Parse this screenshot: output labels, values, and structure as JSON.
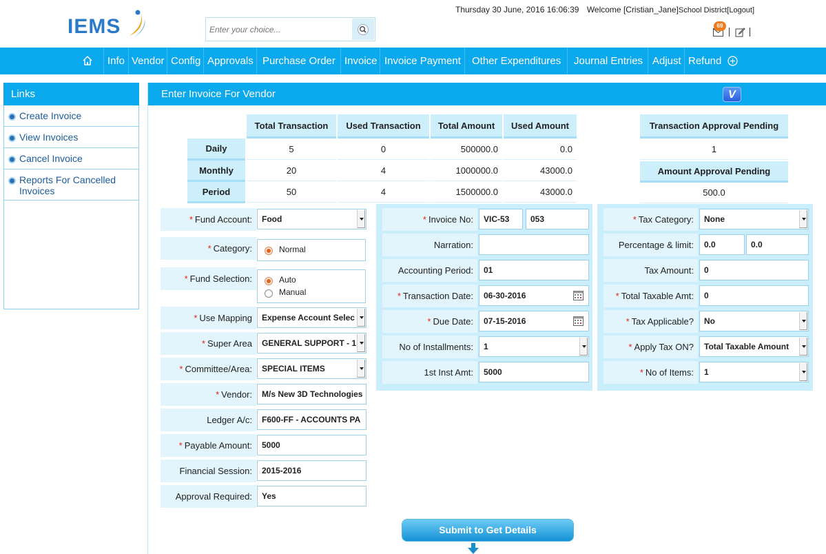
{
  "header": {
    "logo_text": "IEMS",
    "search_placeholder": "Enter your choice...",
    "datetime": "Thursday 30 June, 2016 16:06:39",
    "welcome": "Welcome [Cristian_Jane]",
    "district": "School District",
    "logout": "[Logout]",
    "mail_count": "69"
  },
  "nav": {
    "items": [
      "Info",
      "Vendor",
      "Config",
      "Approvals",
      "Purchase Order",
      "Invoice",
      "Invoice Payment",
      "Other Expenditures",
      "Journal Entries",
      "Adjust",
      "Refund"
    ]
  },
  "sidebar": {
    "title": "Links",
    "items": [
      "Create Invoice",
      "View Invoices",
      "Cancel Invoice",
      "Reports For Cancelled Invoices"
    ]
  },
  "main": {
    "title": "Enter Invoice For Vendor",
    "v_button": "V"
  },
  "stats": {
    "headers": [
      "Total Transaction",
      "Used Transaction",
      "Total Amount",
      "Used Amount"
    ],
    "rows": [
      {
        "label": "Daily",
        "total_tx": "5",
        "used_tx": "0",
        "total_amt": "500000.0",
        "used_amt": "0.0"
      },
      {
        "label": "Monthly",
        "total_tx": "20",
        "used_tx": "4",
        "total_amt": "1000000.0",
        "used_amt": "43000.0"
      },
      {
        "label": "Period",
        "total_tx": "50",
        "used_tx": "4",
        "total_amt": "1500000.0",
        "used_amt": "43000.0"
      }
    ],
    "tx_pending_label": "Transaction Approval Pending",
    "tx_pending_value": "1",
    "amt_pending_label": "Amount Approval Pending",
    "amt_pending_value": "500.0"
  },
  "left_form": {
    "fund_account": {
      "label": "Fund Account:",
      "value": "Food"
    },
    "category": {
      "label": "Category:",
      "option": "Normal"
    },
    "fund_selection": {
      "label": "Fund Selection:",
      "auto": "Auto",
      "manual": "Manual"
    },
    "use_mapping": {
      "label": "Use Mapping",
      "value": "Expense Account Selec"
    },
    "super_area": {
      "label": "Super Area",
      "value": "GENERAL SUPPORT - 1"
    },
    "committee": {
      "label": "Committee/Area:",
      "value": "SPECIAL ITEMS"
    },
    "vendor": {
      "label": "Vendor:",
      "value": "M/s New 3D Technologies"
    },
    "ledger": {
      "label": "Ledger A/c:",
      "value": "F600-FF - ACCOUNTS PA"
    },
    "payable": {
      "label": "Payable Amount:",
      "value": "5000"
    },
    "session": {
      "label": "Financial Session:",
      "value": "2015-2016"
    },
    "approval": {
      "label": "Approval Required:",
      "value": "Yes"
    }
  },
  "mid_form": {
    "invoice_no": {
      "label": "Invoice No:",
      "prefix": "VIC-53",
      "number": "053"
    },
    "narration": {
      "label": "Narration:",
      "value": ""
    },
    "acc_period": {
      "label": "Accounting Period:",
      "value": "01"
    },
    "tx_date": {
      "label": "Transaction Date:",
      "value": "06-30-2016"
    },
    "due_date": {
      "label": "Due Date:",
      "value": "07-15-2016"
    },
    "installments": {
      "label": "No of Installments:",
      "value": "1"
    },
    "first_inst": {
      "label": "1st Inst Amt:",
      "value": "5000"
    }
  },
  "right_form": {
    "tax_category": {
      "label": "Tax Category:",
      "value": "None"
    },
    "percentage": {
      "label": "Percentage & limit:",
      "pct": "0.0",
      "limit": "0.0"
    },
    "tax_amount": {
      "label": "Tax Amount:",
      "value": "0"
    },
    "total_taxable": {
      "label": "Total Taxable Amt:",
      "value": "0"
    },
    "tax_applicable": {
      "label": "Tax Applicable?",
      "value": "No"
    },
    "apply_tax_on": {
      "label": "Apply Tax ON?",
      "value": "Total Taxable Amount"
    },
    "no_items": {
      "label": "No of Items:",
      "value": "1"
    }
  },
  "submit_label": "Submit to Get Details",
  "colors": {
    "nav": "#0aa8ec",
    "panel": "#caeefb",
    "required": "#e2231a"
  }
}
